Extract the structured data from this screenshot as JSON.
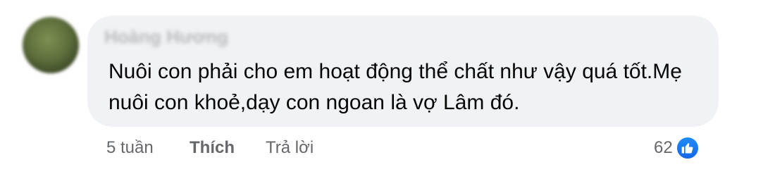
{
  "comment": {
    "author": "Hoàng Hương",
    "text": "Nuôi con phải cho em hoạt động thể chất như vậy quá tốt.Mẹ nuôi con khoẻ,dạy con ngoan là vợ Lâm đó."
  },
  "actions": {
    "time": "5 tuần",
    "like_label": "Thích",
    "reply_label": "Trả lời"
  },
  "reactions": {
    "count": "62",
    "icon": "like-icon",
    "color": "#1877f2"
  },
  "colors": {
    "bubble_bg": "#f0f2f5",
    "text": "#050505",
    "secondary_text": "#65676b"
  }
}
